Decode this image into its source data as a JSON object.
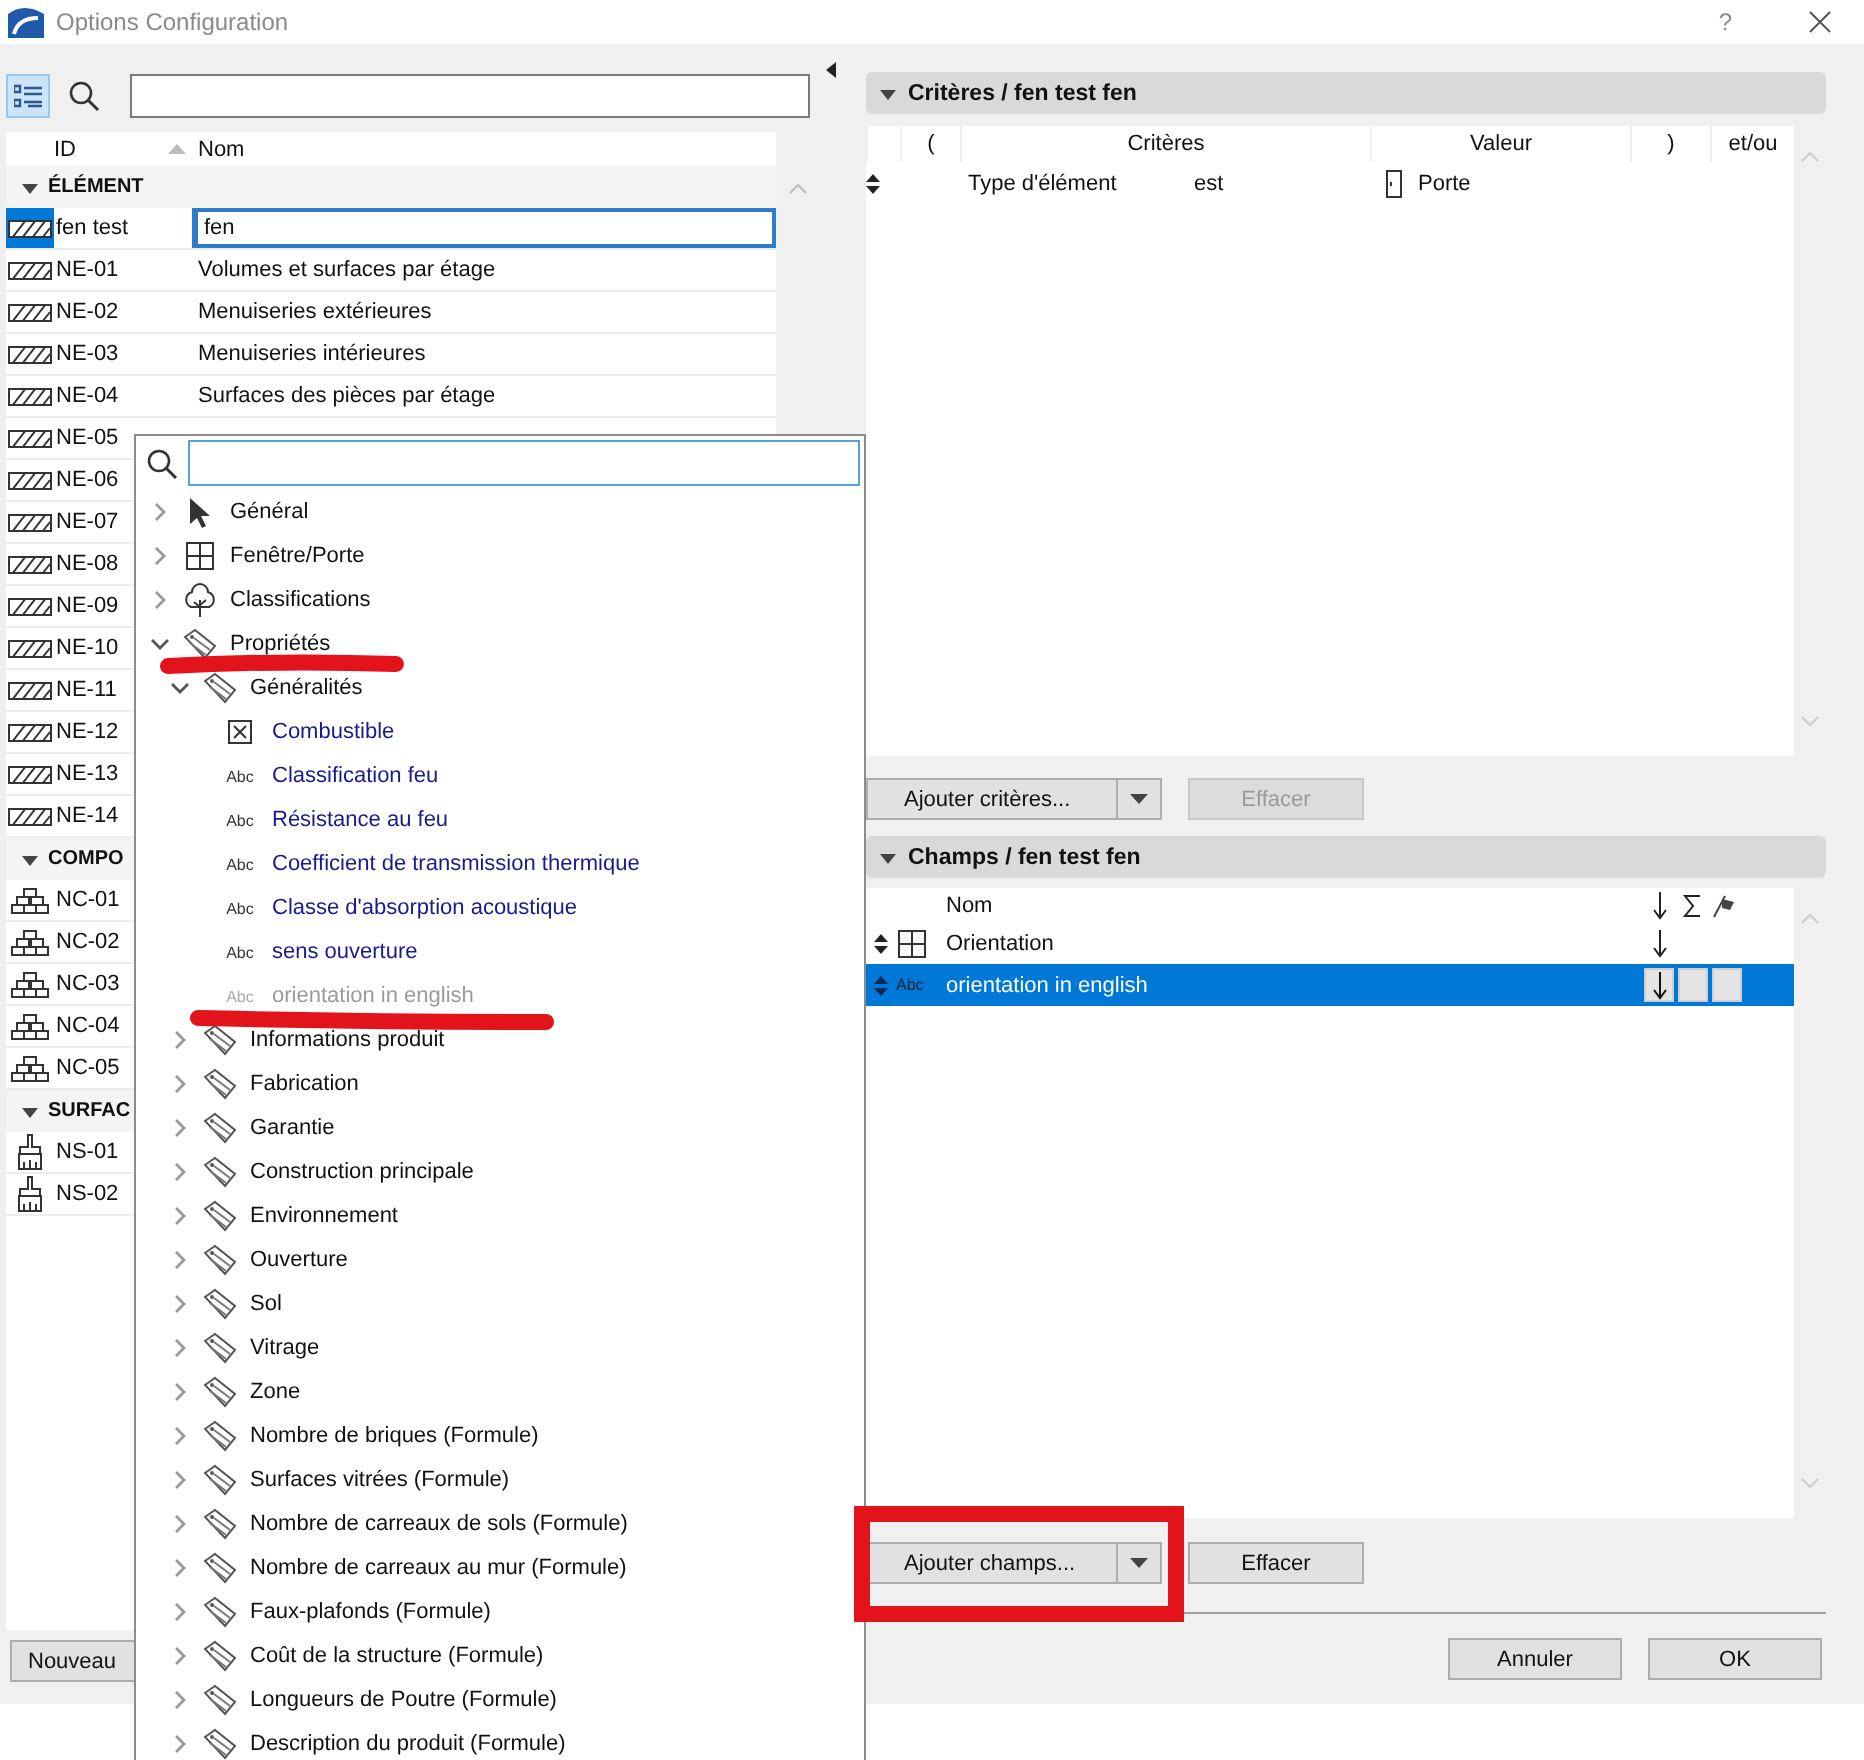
{
  "window": {
    "title": "Options Configuration",
    "help": "?"
  },
  "left_panel": {
    "columns": [
      "ID",
      "Nom"
    ],
    "groups": [
      {
        "title": "ÉLÉMENT",
        "kind": "element",
        "expanded": true,
        "rows": [
          {
            "id": "fen test",
            "name": "fen",
            "selected": true
          },
          {
            "id": "NE-01",
            "name": "Volumes et surfaces par étage",
            "selected": false
          },
          {
            "id": "NE-02",
            "name": "Menuiseries extérieures",
            "selected": false
          },
          {
            "id": "NE-03",
            "name": "Menuiseries intérieures",
            "selected": false
          },
          {
            "id": "NE-04",
            "name": "Surfaces des pièces par étage",
            "selected": false
          },
          {
            "id": "NE-05",
            "selected": false
          },
          {
            "id": "NE-06",
            "selected": false
          },
          {
            "id": "NE-07",
            "selected": false
          },
          {
            "id": "NE-08",
            "selected": false
          },
          {
            "id": "NE-09",
            "selected": false
          },
          {
            "id": "NE-10",
            "selected": false
          },
          {
            "id": "NE-11",
            "selected": false
          },
          {
            "id": "NE-12",
            "selected": false
          },
          {
            "id": "NE-13",
            "selected": false
          },
          {
            "id": "NE-14",
            "selected": false
          }
        ]
      },
      {
        "title": "COMPO",
        "kind": "composite",
        "expanded": true,
        "rows": [
          {
            "id": "NC-01",
            "selected": false
          },
          {
            "id": "NC-02",
            "selected": false
          },
          {
            "id": "NC-03",
            "selected": false
          },
          {
            "id": "NC-04",
            "selected": false
          },
          {
            "id": "NC-05",
            "selected": false
          }
        ]
      },
      {
        "title": "SURFAC",
        "kind": "surface",
        "expanded": true,
        "rows": [
          {
            "id": "NS-01",
            "selected": false
          },
          {
            "id": "NS-02",
            "selected": false
          }
        ]
      }
    ],
    "buttons": [
      "Nouveau"
    ]
  },
  "popup": {
    "tree": [
      {
        "label": "Général",
        "kind": "pointer",
        "expanded": false
      },
      {
        "label": "Fenêtre/Porte",
        "kind": "window",
        "expanded": false
      },
      {
        "label": "Classifications",
        "kind": "classification",
        "expanded": false
      },
      {
        "label": "Propriétés",
        "kind": "property",
        "expanded": true,
        "children": [
          {
            "label": "Généralités",
            "kind": "property",
            "expanded": true,
            "children": [
              {
                "label": "Combustible",
                "kind": "boolean",
                "disabled": false
              },
              {
                "label": "Classification feu",
                "kind": "text",
                "type_label": "Abc",
                "disabled": false
              },
              {
                "label": "Résistance au feu",
                "kind": "text",
                "type_label": "Abc",
                "disabled": false
              },
              {
                "label": "Coefficient de transmission thermique",
                "kind": "text",
                "type_label": "Abc",
                "disabled": false
              },
              {
                "label": "Classe d'absorption acoustique",
                "kind": "text",
                "type_label": "Abc",
                "disabled": false
              },
              {
                "label": "sens ouverture",
                "kind": "text",
                "type_label": "Abc",
                "disabled": false
              },
              {
                "label": "orientation in english",
                "kind": "text",
                "type_label": "Abc",
                "disabled": true
              }
            ]
          },
          {
            "label": "Informations produit",
            "kind": "property",
            "expanded": false
          },
          {
            "label": "Fabrication",
            "kind": "property",
            "expanded": false
          },
          {
            "label": "Garantie",
            "kind": "property",
            "expanded": false
          },
          {
            "label": "Construction principale",
            "kind": "property",
            "expanded": false
          },
          {
            "label": "Environnement",
            "kind": "property",
            "expanded": false
          },
          {
            "label": "Ouverture",
            "kind": "property",
            "expanded": false
          },
          {
            "label": "Sol",
            "kind": "property",
            "expanded": false
          },
          {
            "label": "Vitrage",
            "kind": "property",
            "expanded": false
          },
          {
            "label": "Zone",
            "kind": "property",
            "expanded": false
          },
          {
            "label": "Nombre de briques (Formule)",
            "kind": "property",
            "expanded": false
          },
          {
            "label": "Surfaces vitrées (Formule)",
            "kind": "property",
            "expanded": false
          },
          {
            "label": "Nombre de carreaux de sols (Formule)",
            "kind": "property",
            "expanded": false
          },
          {
            "label": "Nombre de carreaux au mur (Formule)",
            "kind": "property",
            "expanded": false
          },
          {
            "label": "Faux-plafonds (Formule)",
            "kind": "property",
            "expanded": false
          },
          {
            "label": "Coût de la structure (Formule)",
            "kind": "property",
            "expanded": false
          },
          {
            "label": "Longueurs de Poutre (Formule)",
            "kind": "property",
            "expanded": false
          },
          {
            "label": "Description du produit (Formule)",
            "kind": "property",
            "expanded": false
          }
        ]
      }
    ]
  },
  "criteria": {
    "title": "Critères / fen test fen",
    "expanded": true,
    "columns": [
      "(",
      "Critères",
      "Valeur",
      ")",
      "et/ou"
    ],
    "rows": [
      {
        "criterion": "Type d'élément",
        "operator": "est",
        "value": "Porte"
      }
    ],
    "buttons": [
      {
        "label": "Ajouter critères...",
        "kind": "split",
        "disabled": false
      },
      {
        "label": "Effacer",
        "kind": "plain",
        "disabled": true
      }
    ]
  },
  "fields": {
    "title": "Champs / fen test fen",
    "expanded": true,
    "columns": [
      "Nom"
    ],
    "rows": [
      {
        "name": "Orientation",
        "kind": "window",
        "selected": false,
        "sort_down": true
      },
      {
        "name": "orientation in english",
        "kind": "text",
        "type_label": "Abc",
        "selected": true,
        "sort_down": true
      }
    ],
    "buttons": [
      {
        "label": "Ajouter champs...",
        "kind": "split",
        "disabled": false
      },
      {
        "label": "Effacer",
        "kind": "plain",
        "disabled": false
      }
    ]
  },
  "dialog_buttons": [
    "Annuler",
    "OK"
  ]
}
